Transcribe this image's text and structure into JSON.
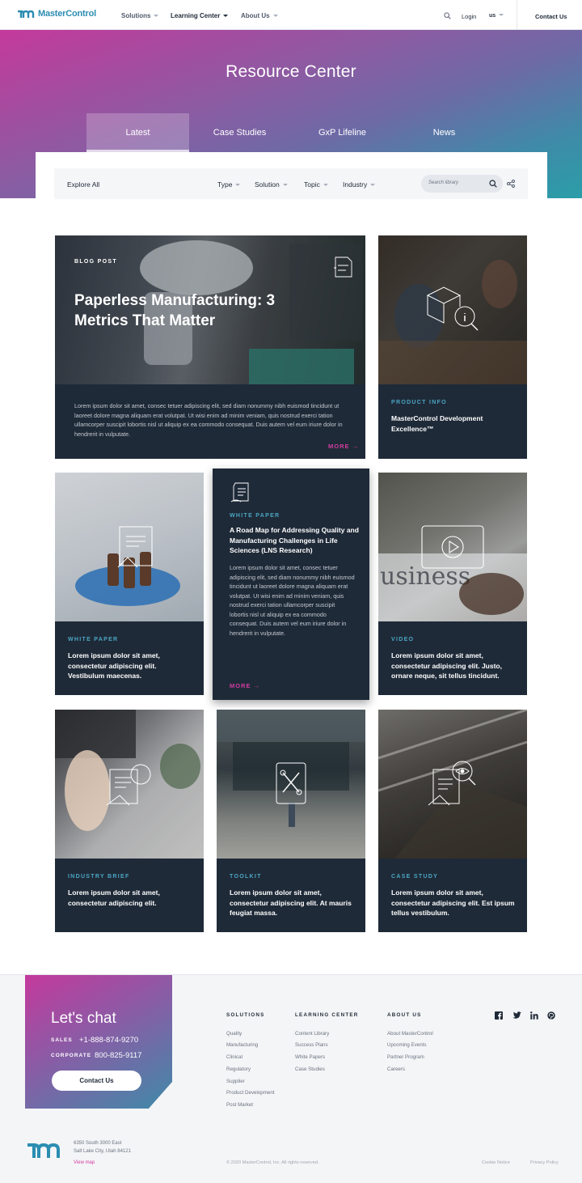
{
  "nav": {
    "brand": "MasterControl",
    "links": [
      "Solutions",
      "Learning Center",
      "About Us"
    ],
    "login": "Login",
    "locale": "us",
    "contact": "Contact Us"
  },
  "hero": {
    "title": "Resource Center",
    "tabs": [
      "Latest",
      "Case Studies",
      "GxP Lifeline",
      "News"
    ]
  },
  "filters": {
    "explore": "Explore All",
    "items": [
      "Type",
      "Solution",
      "Topic",
      "Industry"
    ],
    "search_placeholder": "Search library"
  },
  "cards": [
    {
      "tag": "BLOG POST",
      "title": "Paperless Manufacturing: 3 Metrics That Matter",
      "body": "Lorem ipsum dolor sit amet, consec tetuer adipiscing elit, sed diam nonummy nibh euismod tincidunt ut laoreet dolore magna aliquam erat volutpat. Ut wisi enim ad minim veniam, quis nostrud exerci tation ullamcorper suscipit lobortis nisl ut aliquip ex ea commodo consequat. Duis autem vel eum iriure dolor in hendrerit in vulputate.",
      "more": "MORE"
    },
    {
      "tag": "PRODUCT INFO",
      "title": "MasterControl Development Excellence™"
    },
    {
      "tag": "WHITE PAPER",
      "title": "Lorem ipsum dolor sit amet, consectetur adipiscing elit. Vestibulum maecenas."
    },
    {
      "tag": "WHITE PAPER",
      "title": "A Road Map for Addressing Quality and Manufacturing Challenges in Life Sciences (LNS Research)",
      "body": "Lorem ipsum dolor sit amet, consec tetuer adipiscing elit, sed diam nonummy nibh euismod tincidunt ut laoreet dolore magna aliquam erat volutpat. Ut wisi enim ad minim veniam, quis nostrud exerci tation ullamcorper suscipit lobortis nisl ut aliquip ex ea commodo consequat. Duis autem vel eum iriure dolor in hendrerit in vulputate.",
      "more": "MORE"
    },
    {
      "tag": "VIDEO",
      "title": "Lorem ipsum dolor sit amet, consectetur adipiscing elit. Justo, ornare neque, sit tellus tincidunt."
    },
    {
      "tag": "INDUSTRY BRIEF",
      "title": "Lorem ipsum dolor sit amet, consectetur adipiscing elit."
    },
    {
      "tag": "TOOLKIT",
      "title": "Lorem ipsum dolor sit amet, consectetur adipiscing elit. At mauris feugiat massa."
    },
    {
      "tag": "CASE STUDY",
      "title": "Lorem ipsum dolor sit amet, consectetur adipiscing elit. Est ipsum tellus vestibulum."
    }
  ],
  "footer": {
    "chat_title": "Let's chat",
    "sales_label": "SALES",
    "sales_number": "+1-888-874-9270",
    "corporate_label": "CORPORATE",
    "corporate_number": "800-825-9117",
    "contact_button": "Contact Us",
    "columns": [
      {
        "heading": "SOLUTIONS",
        "links": [
          "Quality",
          "Manufacturing",
          "Clinical",
          "Regulatory",
          "Supplier",
          "Product Development",
          "Post Market"
        ]
      },
      {
        "heading": "LEARNING CENTER",
        "links": [
          "Content Library",
          "Success Plans",
          "White Papers",
          "Case Studies"
        ]
      },
      {
        "heading": "ABOUT US",
        "links": [
          "About MasterControl",
          "Upcoming Events",
          "Partner Program",
          "Careers"
        ]
      }
    ],
    "address_line1": "6350 South 3000 East",
    "address_line2": "Salt Lake City, Utah 84121",
    "view_map": "View map",
    "copyright": "© 2020 MasterControl, Inc. All rights reserved.",
    "cookie": "Cookie Notice",
    "privacy": "Privacy Policy"
  },
  "colors": {
    "accent_teal": "#2b8db2",
    "accent_magenta": "#d23da0",
    "card_navy": "#1f2a38"
  }
}
